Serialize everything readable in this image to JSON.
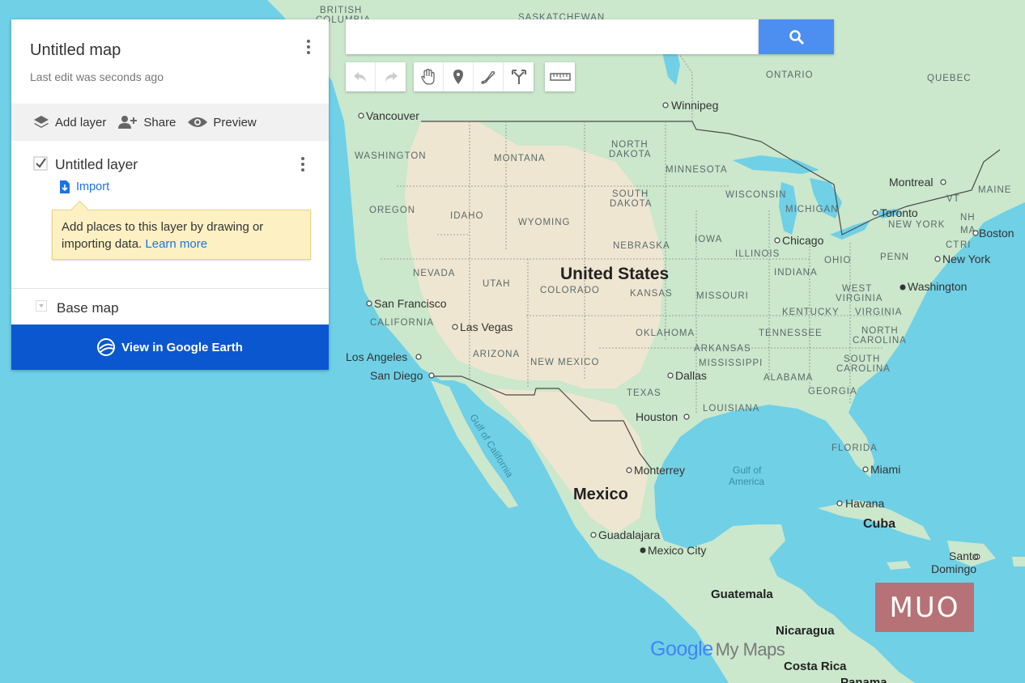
{
  "panel": {
    "title": "Untitled map",
    "subtitle": "Last edit was seconds ago",
    "actions": {
      "add_layer": "Add layer",
      "share": "Share",
      "preview": "Preview"
    },
    "layer": {
      "name": "Untitled layer",
      "checked": true,
      "import_label": "Import",
      "tip_text": "Add places to this layer by drawing or importing data.",
      "tip_link": "Learn more"
    },
    "base_map": "Base map",
    "earth_button": "View in Google Earth"
  },
  "search": {
    "value": "",
    "placeholder": ""
  },
  "toolbar": {
    "tools": [
      "undo-icon",
      "redo-icon",
      "hand-icon",
      "marker-icon",
      "draw-line-icon",
      "directions-icon",
      "ruler-icon"
    ]
  },
  "map": {
    "countries": [
      "United States",
      "Mexico",
      "Cuba",
      "Guatemala",
      "Nicaragua",
      "Costa Rica",
      "Panama"
    ],
    "provinces": [
      "BRITISH COLUMBIA",
      "SASKATCHEWAN",
      "ONTARIO",
      "QUEBEC",
      "WASHINGTON",
      "MONTANA",
      "NORTH DAKOTA",
      "MINNESOTA",
      "OREGON",
      "IDAHO",
      "WYOMING",
      "SOUTH DAKOTA",
      "WISCONSIN",
      "MICHIGAN",
      "NEW YORK",
      "MAINE",
      "VT",
      "NH",
      "MA",
      "CT",
      "RI",
      "NEBRASKA",
      "IOWA",
      "ILLINOIS",
      "OHIO",
      "PENN",
      "NEVADA",
      "UTAH",
      "COLORADO",
      "KANSAS",
      "MISSOURI",
      "INDIANA",
      "WEST VIRGINIA",
      "KENTUCKY",
      "VIRGINIA",
      "CALIFORNIA",
      "ARIZONA",
      "NEW MEXICO",
      "OKLAHOMA",
      "TENNESSEE",
      "NORTH CAROLINA",
      "ARKANSAS",
      "MISSISSIPPI",
      "ALABAMA",
      "SOUTH CAROLINA",
      "GEORGIA",
      "TEXAS",
      "LOUISIANA",
      "FLORIDA"
    ],
    "cities": [
      "Vancouver",
      "Winnipeg",
      "Montreal",
      "Toronto",
      "Boston",
      "Chicago",
      "New York",
      "Washington",
      "San Francisco",
      "Las Vegas",
      "Los Angeles",
      "San Diego",
      "Dallas",
      "Houston",
      "Monterrey",
      "Miami",
      "Havana",
      "Guadalajara",
      "Mexico City",
      "Santo Domingo"
    ],
    "water": [
      "Gulf of California",
      "Gulf of America"
    ]
  },
  "brand": {
    "google": "Google",
    "my_maps": "My Maps",
    "watermark": "MUO"
  },
  "colors": {
    "water": "#6fd0e6",
    "land": "#c8e6c9",
    "desert": "#efe6d2",
    "accent": "#4d8ff0",
    "earth_button": "#0b57d0"
  }
}
